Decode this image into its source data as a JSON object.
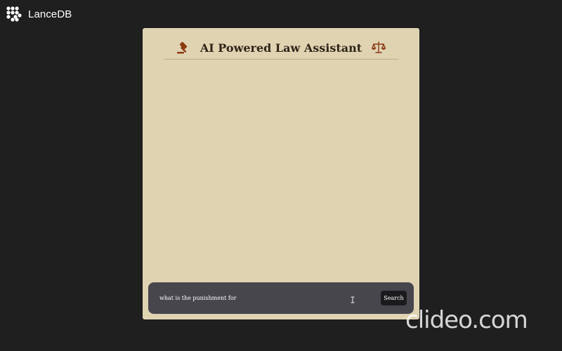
{
  "brand": {
    "name": "LanceDB",
    "icon": "lancedb-logo-icon"
  },
  "card": {
    "title": "AI Powered Law Assistant",
    "left_icon": "gavel-icon",
    "right_icon": "scales-icon",
    "background_color": "#dfd3b2",
    "accent_color": "#8b3a12"
  },
  "search": {
    "value": "what is the punishment for",
    "button_label": "Search",
    "cursor_icon": "text-cursor-icon"
  },
  "watermark": {
    "text": "clideo.com"
  }
}
